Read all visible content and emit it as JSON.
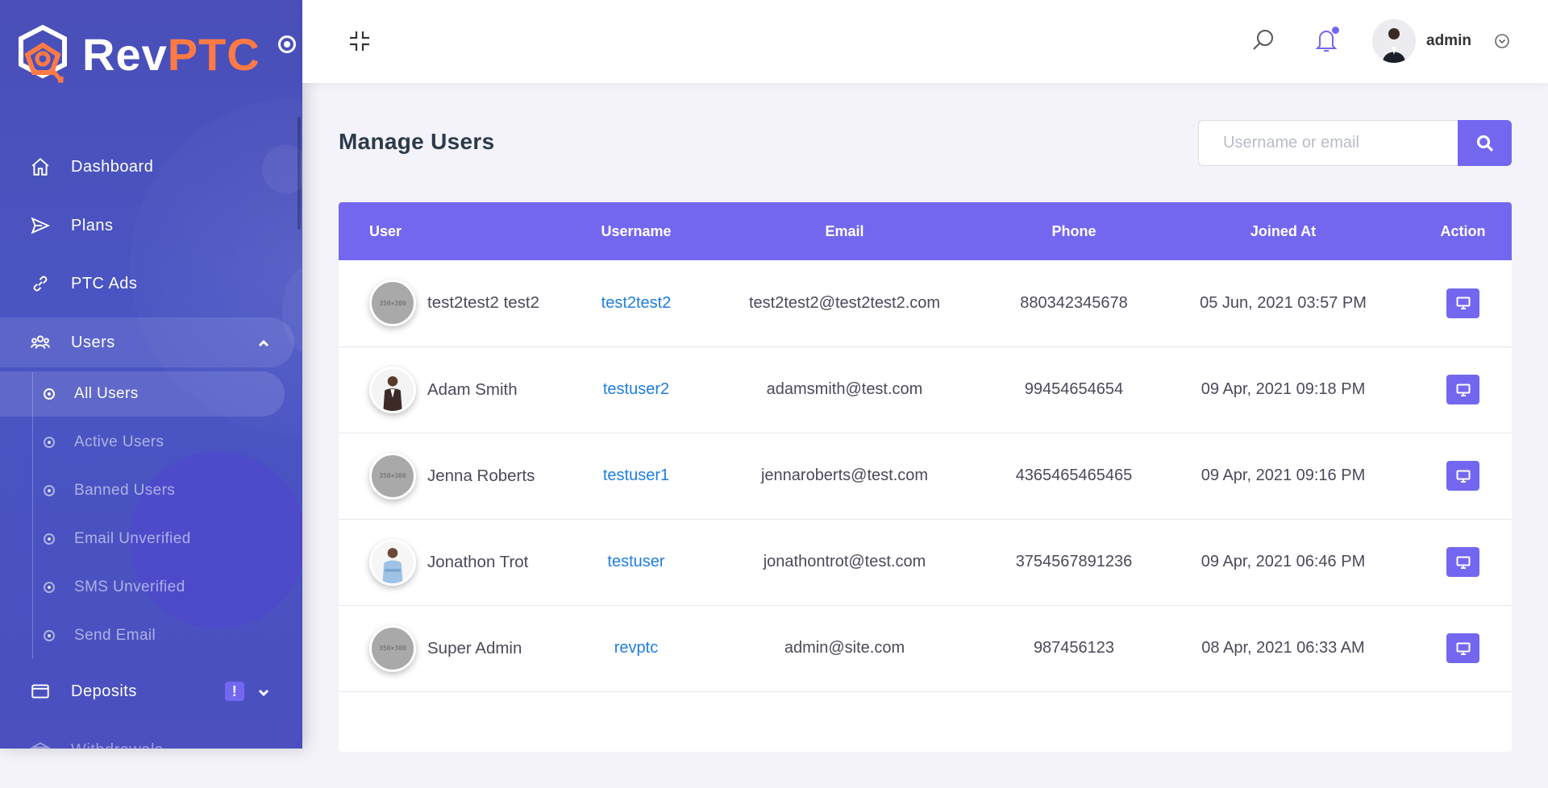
{
  "brand": {
    "name_part1": "Rev",
    "name_part2": "PTC"
  },
  "colors": {
    "accent": "#7367f0",
    "sidebar": "#4a52c2",
    "logo_orange": "#ff7a45",
    "link": "#1f7de2"
  },
  "sidebar": {
    "items": [
      {
        "label": "Dashboard",
        "icon": "home-icon"
      },
      {
        "label": "Plans",
        "icon": "send-icon"
      },
      {
        "label": "PTC Ads",
        "icon": "link-icon"
      },
      {
        "label": "Users",
        "icon": "users-icon",
        "expanded": true
      },
      {
        "label": "Deposits",
        "icon": "credit-card-icon",
        "badge": "!"
      },
      {
        "label": "Withdrawals",
        "icon": "bank-icon"
      }
    ],
    "users_submenu": [
      {
        "label": "All Users",
        "active": true
      },
      {
        "label": "Active Users"
      },
      {
        "label": "Banned Users"
      },
      {
        "label": "Email Unverified"
      },
      {
        "label": "SMS Unverified"
      },
      {
        "label": "Send Email"
      }
    ]
  },
  "topbar": {
    "username": "admin"
  },
  "page": {
    "title": "Manage Users",
    "search_placeholder": "Username or email"
  },
  "table": {
    "headers": [
      "User",
      "Username",
      "Email",
      "Phone",
      "Joined At",
      "Action"
    ],
    "rows": [
      {
        "name": "test2test2 test2",
        "username": "test2test2",
        "email": "test2test2@test2test2.com",
        "phone": "880342345678",
        "joined": "05 Jun, 2021 03:57 PM",
        "avatar": "placeholder",
        "placeholder_text": "350×300"
      },
      {
        "name": "Adam Smith",
        "username": "testuser2",
        "email": "adamsmith@test.com",
        "phone": "99454654654",
        "joined": "09 Apr, 2021 09:18 PM",
        "avatar": "photo-dark-suit"
      },
      {
        "name": "Jenna Roberts",
        "username": "testuser1",
        "email": "jennaroberts@test.com",
        "phone": "4365465465465",
        "joined": "09 Apr, 2021 09:16 PM",
        "avatar": "placeholder",
        "placeholder_text": "350×300"
      },
      {
        "name": "Jonathon Trot",
        "username": "testuser",
        "email": "jonathontrot@test.com",
        "phone": "3754567891236",
        "joined": "09 Apr, 2021 06:46 PM",
        "avatar": "photo-blue-shirt"
      },
      {
        "name": "Super Admin",
        "username": "revptc",
        "email": "admin@site.com",
        "phone": "987456123",
        "joined": "08 Apr, 2021 06:33 AM",
        "avatar": "placeholder",
        "placeholder_text": "350×300"
      }
    ]
  }
}
